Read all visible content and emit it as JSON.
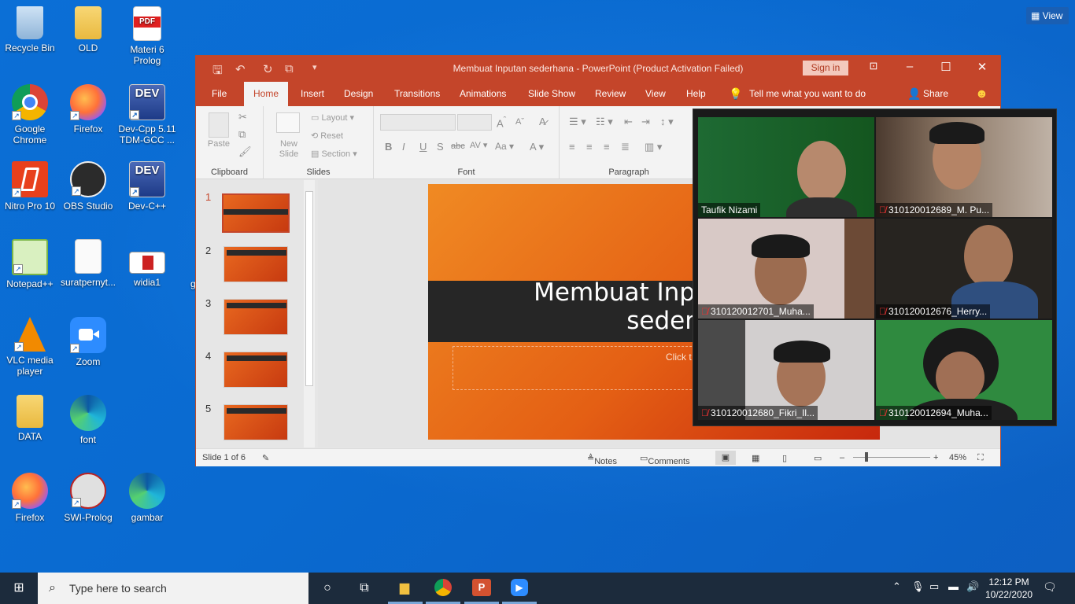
{
  "desktop": {
    "view_button": "View",
    "icons": [
      {
        "label": "Recycle Bin"
      },
      {
        "label": "OLD"
      },
      {
        "label": "Materi 6 Prolog"
      },
      {
        "label": "Google Chrome"
      },
      {
        "label": "Firefox"
      },
      {
        "label": "Dev-Cpp 5.11 TDM-GCC ..."
      },
      {
        "label": "Nitro Pro 10"
      },
      {
        "label": "OBS Studio"
      },
      {
        "label": "Dev-C++"
      },
      {
        "label": "Notepad++"
      },
      {
        "label": "suratpernyt..."
      },
      {
        "label": "widia1"
      },
      {
        "label": "VLC media player"
      },
      {
        "label": "Zoom"
      },
      {
        "label": "DATA"
      },
      {
        "label": "font"
      },
      {
        "label": "Firefox"
      },
      {
        "label": "SWI-Prolog"
      },
      {
        "label": "gambar"
      }
    ],
    "partial_icon_label": "g"
  },
  "powerpoint": {
    "title": "Membuat Inputan sederhana  -  PowerPoint (Product Activation Failed)",
    "sign_in": "Sign in",
    "tabs": [
      "File",
      "Home",
      "Insert",
      "Design",
      "Transitions",
      "Animations",
      "Slide Show",
      "Review",
      "View",
      "Help"
    ],
    "tell_me": "Tell me what you want to do",
    "share": "Share",
    "ribbon": {
      "paste": "Paste",
      "clipboard": "Clipboard",
      "new_slide": "New Slide",
      "layout": "Layout",
      "reset": "Reset",
      "section": "Section",
      "slides": "Slides",
      "font": "Font",
      "paragraph": "Paragraph"
    },
    "thumbnails": [
      "1",
      "2",
      "3",
      "4",
      "5"
    ],
    "slide": {
      "title_line1": "Membuat Inp",
      "title_line2": "seder",
      "subtitle_placeholder": "Click t"
    },
    "status": {
      "slide_info": "Slide 1 of 6",
      "notes": "Notes",
      "comments": "Comments",
      "zoom": "45%"
    }
  },
  "zoom_meeting": {
    "participants": [
      {
        "name": "Taufik Nizami",
        "muted": false
      },
      {
        "name": "310120012689_M. Pu...",
        "muted": true
      },
      {
        "name": "310120012701_Muha...",
        "muted": true
      },
      {
        "name": "310120012676_Herry...",
        "muted": true
      },
      {
        "name": "310120012680_Fikri_Il...",
        "muted": true
      },
      {
        "name": "310120012694_Muha...",
        "muted": true
      }
    ]
  },
  "taskbar": {
    "search_placeholder": "Type here to search",
    "time": "12:12 PM",
    "date": "10/22/2020"
  }
}
